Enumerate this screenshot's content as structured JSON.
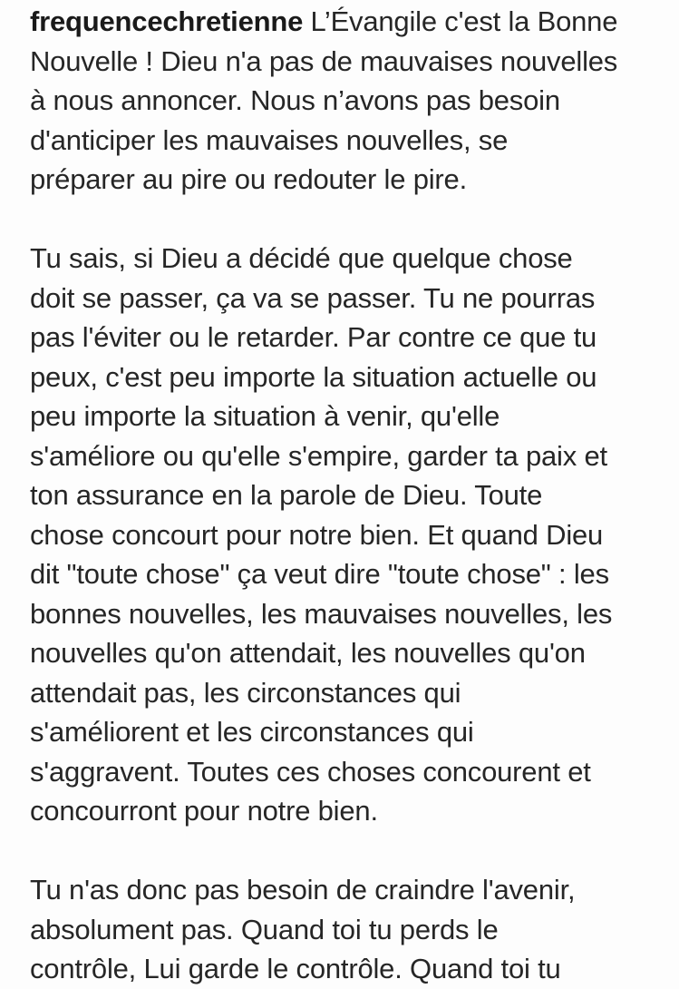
{
  "post": {
    "username": "frequencechretienne",
    "paragraphs": [
      [
        " L’Évangile c'est la Bonne",
        "Nouvelle ! Dieu n'a pas de mauvaises nouvelles",
        "à nous annoncer. Nous n’avons pas besoin",
        "d'anticiper les mauvaises nouvelles, se",
        "préparer au pire ou redouter le pire."
      ],
      [
        "Tu sais, si Dieu a décidé que quelque chose",
        "doit se passer, ça va se passer. Tu ne pourras",
        "pas l'éviter ou le retarder. Par contre ce que tu",
        "peux, c'est peu importe la situation actuelle ou",
        "peu importe la situation à venir, qu'elle",
        "s'améliore ou qu'elle s'empire, garder ta paix et",
        "ton assurance en la parole de Dieu. Toute",
        "chose concourt pour notre bien. Et quand Dieu",
        "dit \"toute chose\" ça veut dire \"toute chose\" : les",
        "bonnes nouvelles, les mauvaises nouvelles, les",
        "nouvelles qu'on attendait, les nouvelles qu'on",
        "attendait pas, les circonstances qui",
        "s'améliorent et les circonstances qui",
        "s'aggravent. Toutes ces choses concourent et",
        "concourront pour notre bien."
      ],
      [
        "Tu n'as donc pas besoin de craindre l'avenir,",
        "absolument pas. Quand toi tu perds le",
        "contrôle, Lui garde le contrôle. Quand toi tu"
      ]
    ]
  }
}
